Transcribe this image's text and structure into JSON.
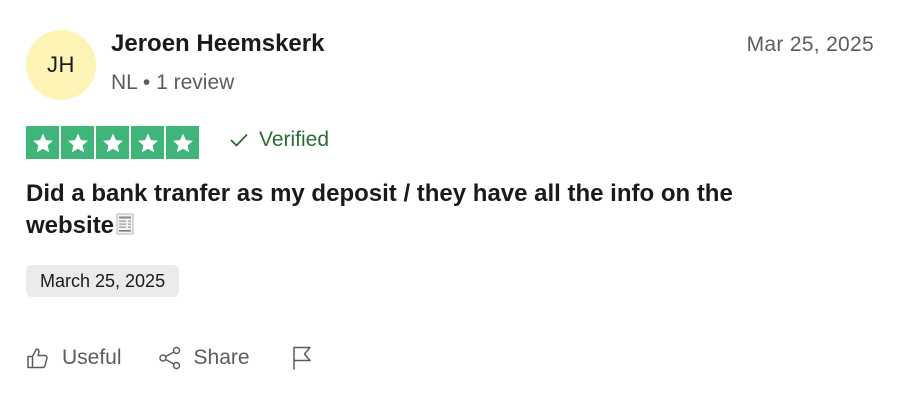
{
  "reviewer": {
    "initials": "JH",
    "name": "Jeroen Heemskerk",
    "meta": "NL • 1 review",
    "avatar_color": "#fdf4b6"
  },
  "review": {
    "date": "Mar 25, 2025",
    "rating": 5,
    "max_rating": 5,
    "star_color": "#3fb57a",
    "verified_label": "Verified",
    "text": "Did a bank tranfer as my deposit / they have all the info on the website",
    "text_emoji": "receipt-icon",
    "experience_date": "March 25, 2025"
  },
  "actions": {
    "useful_label": "Useful",
    "share_label": "Share",
    "report_icon": "flag-icon"
  }
}
